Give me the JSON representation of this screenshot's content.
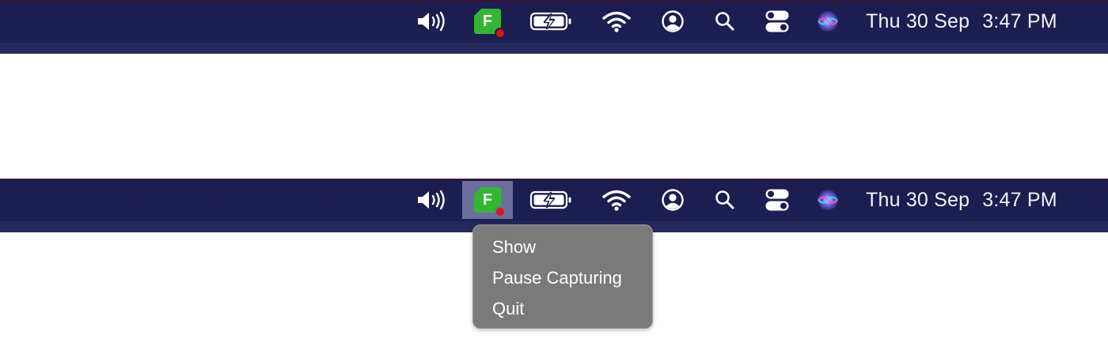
{
  "menubar": {
    "status_items": [
      {
        "icon": "speaker-volume-icon"
      },
      {
        "icon": "app-f-icon",
        "label": "F"
      },
      {
        "icon": "battery-charging-icon"
      },
      {
        "icon": "wifi-icon"
      },
      {
        "icon": "user-account-icon"
      },
      {
        "icon": "spotlight-search-icon"
      },
      {
        "icon": "control-center-icon"
      },
      {
        "icon": "siri-icon"
      }
    ],
    "date": "Thu 30 Sep",
    "time": "3:47 PM"
  },
  "app_menu": {
    "items": [
      "Show",
      "Pause Capturing",
      "Quit"
    ]
  },
  "colors": {
    "menubar_bg": "#1c1c4f",
    "app_green": "#35b534",
    "recording_red": "#d9141b",
    "menu_bg": "#7a7a7a",
    "active_highlight": "#6c6f9c"
  }
}
